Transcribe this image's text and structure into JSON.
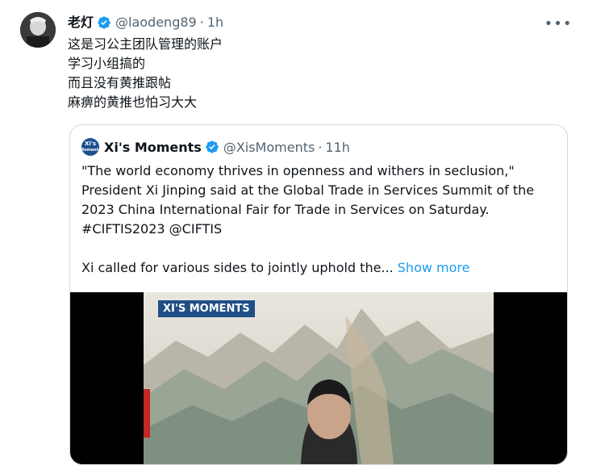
{
  "tweet": {
    "display_name": "老灯",
    "handle": "@laodeng89",
    "separator": "·",
    "time": "1h",
    "lines": [
      "这是习公主团队管理的账户",
      "学习小组搞的",
      "而且没有黄推跟帖",
      "麻痹的黄推也怕习大大"
    ]
  },
  "quote": {
    "avatar_lines": [
      "Xi's",
      "Moments"
    ],
    "display_name": "Xi's Moments",
    "handle": "@XisMoments",
    "separator": "·",
    "time": "11h",
    "lines": [
      "\"The world economy thrives in openness and withers in seclusion,\"",
      "President Xi Jinping said at the Global Trade in Services Summit of the",
      "2023 China International Fair for Trade in Services on Saturday.",
      "#CIFTIS2023  @CIFTIS"
    ],
    "truncated_line": "Xi called for various sides to jointly uphold the... ",
    "show_more": "Show more",
    "video_badge": "XI'S MOMENTS"
  },
  "colors": {
    "verified": "#1d9bf0",
    "link": "#1d9bf0",
    "muted": "#536471",
    "border": "#cfd9de"
  },
  "icons": {
    "verified": "verified-badge-icon",
    "more": "more-options-icon"
  }
}
